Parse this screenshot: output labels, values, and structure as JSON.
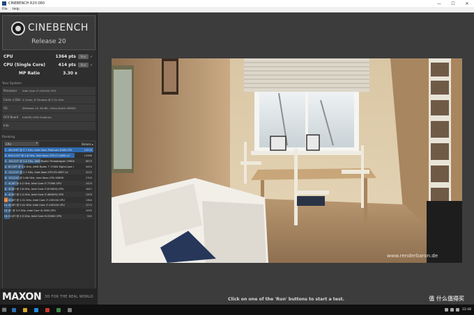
{
  "window": {
    "title": "CINEBENCH R20.060",
    "ctrl_min": "—",
    "ctrl_max": "☐",
    "ctrl_close": "✕"
  },
  "menu": {
    "items": [
      "File",
      "Help"
    ]
  },
  "logo": {
    "name": "CINEBENCH",
    "release": "Release 20"
  },
  "scores": {
    "cpu_label": "CPU",
    "cpu_value": "1364 pts",
    "cpu_run": "Run",
    "single_label": "CPU (Single Core)",
    "single_value": "414 pts",
    "single_run": "Run",
    "ratio_label": "MP Ratio",
    "ratio_value": "3.30 x"
  },
  "system": {
    "header": "Your System",
    "rows": [
      {
        "key": "Processor",
        "value": "Intel Core i7-10510U CPU"
      },
      {
        "key": "Cores x GHz",
        "value": "4 Cores, 8 Threads @ 2.31 GHz"
      },
      {
        "key": "OS",
        "value": "Windows 10, 64 Bit, China (build 18363)"
      },
      {
        "key": "GFX Board",
        "value": "Intel(R) UHD Graphics"
      },
      {
        "key": "Info",
        "value": ""
      }
    ]
  },
  "ranking": {
    "header": "Ranking",
    "select": "CPU",
    "details": "Details",
    "rows": [
      {
        "n": "1.",
        "desc": "48C/96T @ 2.7 GHz, Intel Xeon Platinum 8168 CPU",
        "score": "16536",
        "frac": 1.0,
        "kind": "sel"
      },
      {
        "n": "2.",
        "desc": "60C/120T @ 2.8 GHz, Intel Xeon CPU E7-4890 v2",
        "score": "12986",
        "frac": 0.79,
        "kind": "sel"
      },
      {
        "n": "3.",
        "desc": "16C/32T @ 3.4 GHz, AMD Ryzen Threadripper 1950X",
        "score": "6670",
        "frac": 0.41,
        "kind": ""
      },
      {
        "n": "4.",
        "desc": "8C/16T @ 3.4 GHz, AMD Ryzen 7 1700X Eight-Core I",
        "score": "3455",
        "frac": 0.22,
        "kind": ""
      },
      {
        "n": "5.",
        "desc": "12C/24T @ 2.7 GHz, Intel Xeon CPU E5-2697 v2",
        "score": "3225",
        "frac": 0.2,
        "kind": ""
      },
      {
        "n": "6.",
        "desc": "12C/24T @ 2.66 GHz, Intel Xeon CPU X5650",
        "score": "2705",
        "frac": 0.17,
        "kind": ""
      },
      {
        "n": "7.",
        "desc": "4C/8T @ 4.2 GHz, Intel Core i7-7700K CPU",
        "score": "2420",
        "frac": 0.15,
        "kind": ""
      },
      {
        "n": "8.",
        "desc": "4C/8T @ 2.6 GHz, Intel Core i7-6700HQ CPU",
        "score": "1647",
        "frac": 0.11,
        "kind": ""
      },
      {
        "n": "9.",
        "desc": "4C/8T @ 2.3 GHz, Intel Core i7-4850HQ CPU",
        "score": "1509",
        "frac": 0.1,
        "kind": ""
      },
      {
        "n": "10.",
        "desc": "4C/8T @ 2.31 GHz, Intel Core i7-10510U CPU",
        "score": "1364",
        "frac": 0.09,
        "kind": "mine"
      },
      {
        "n": "11.",
        "desc": "4C/8T @ 2.01 GHz, Intel Core i7-10510U CPU",
        "score": "1272",
        "frac": 0.08,
        "kind": ""
      },
      {
        "n": "12.",
        "desc": "4C @ 3.3 GHz, Intel Core i5-3550 CPU",
        "score": "1059",
        "frac": 0.07,
        "kind": ""
      },
      {
        "n": "13.",
        "desc": "2C/4T @ 2.3 GHz, Intel Core i5-5300U CPU",
        "score": "541",
        "frac": 0.04,
        "kind": ""
      }
    ]
  },
  "legend": {
    "your_score": "Your Score",
    "identical": "Identical System",
    "your_color": "#d5782e",
    "identical_color": "#3a5f85"
  },
  "brand": {
    "name": "MAXON",
    "tagline": "3D FOR THE REAL WORLD"
  },
  "render": {
    "credit": "www.renderbaron.de"
  },
  "status": "Click on one of the 'Run' buttons to start a test.",
  "taskbar": {
    "clock": "22:48"
  },
  "watermark": "值 什么值得买"
}
